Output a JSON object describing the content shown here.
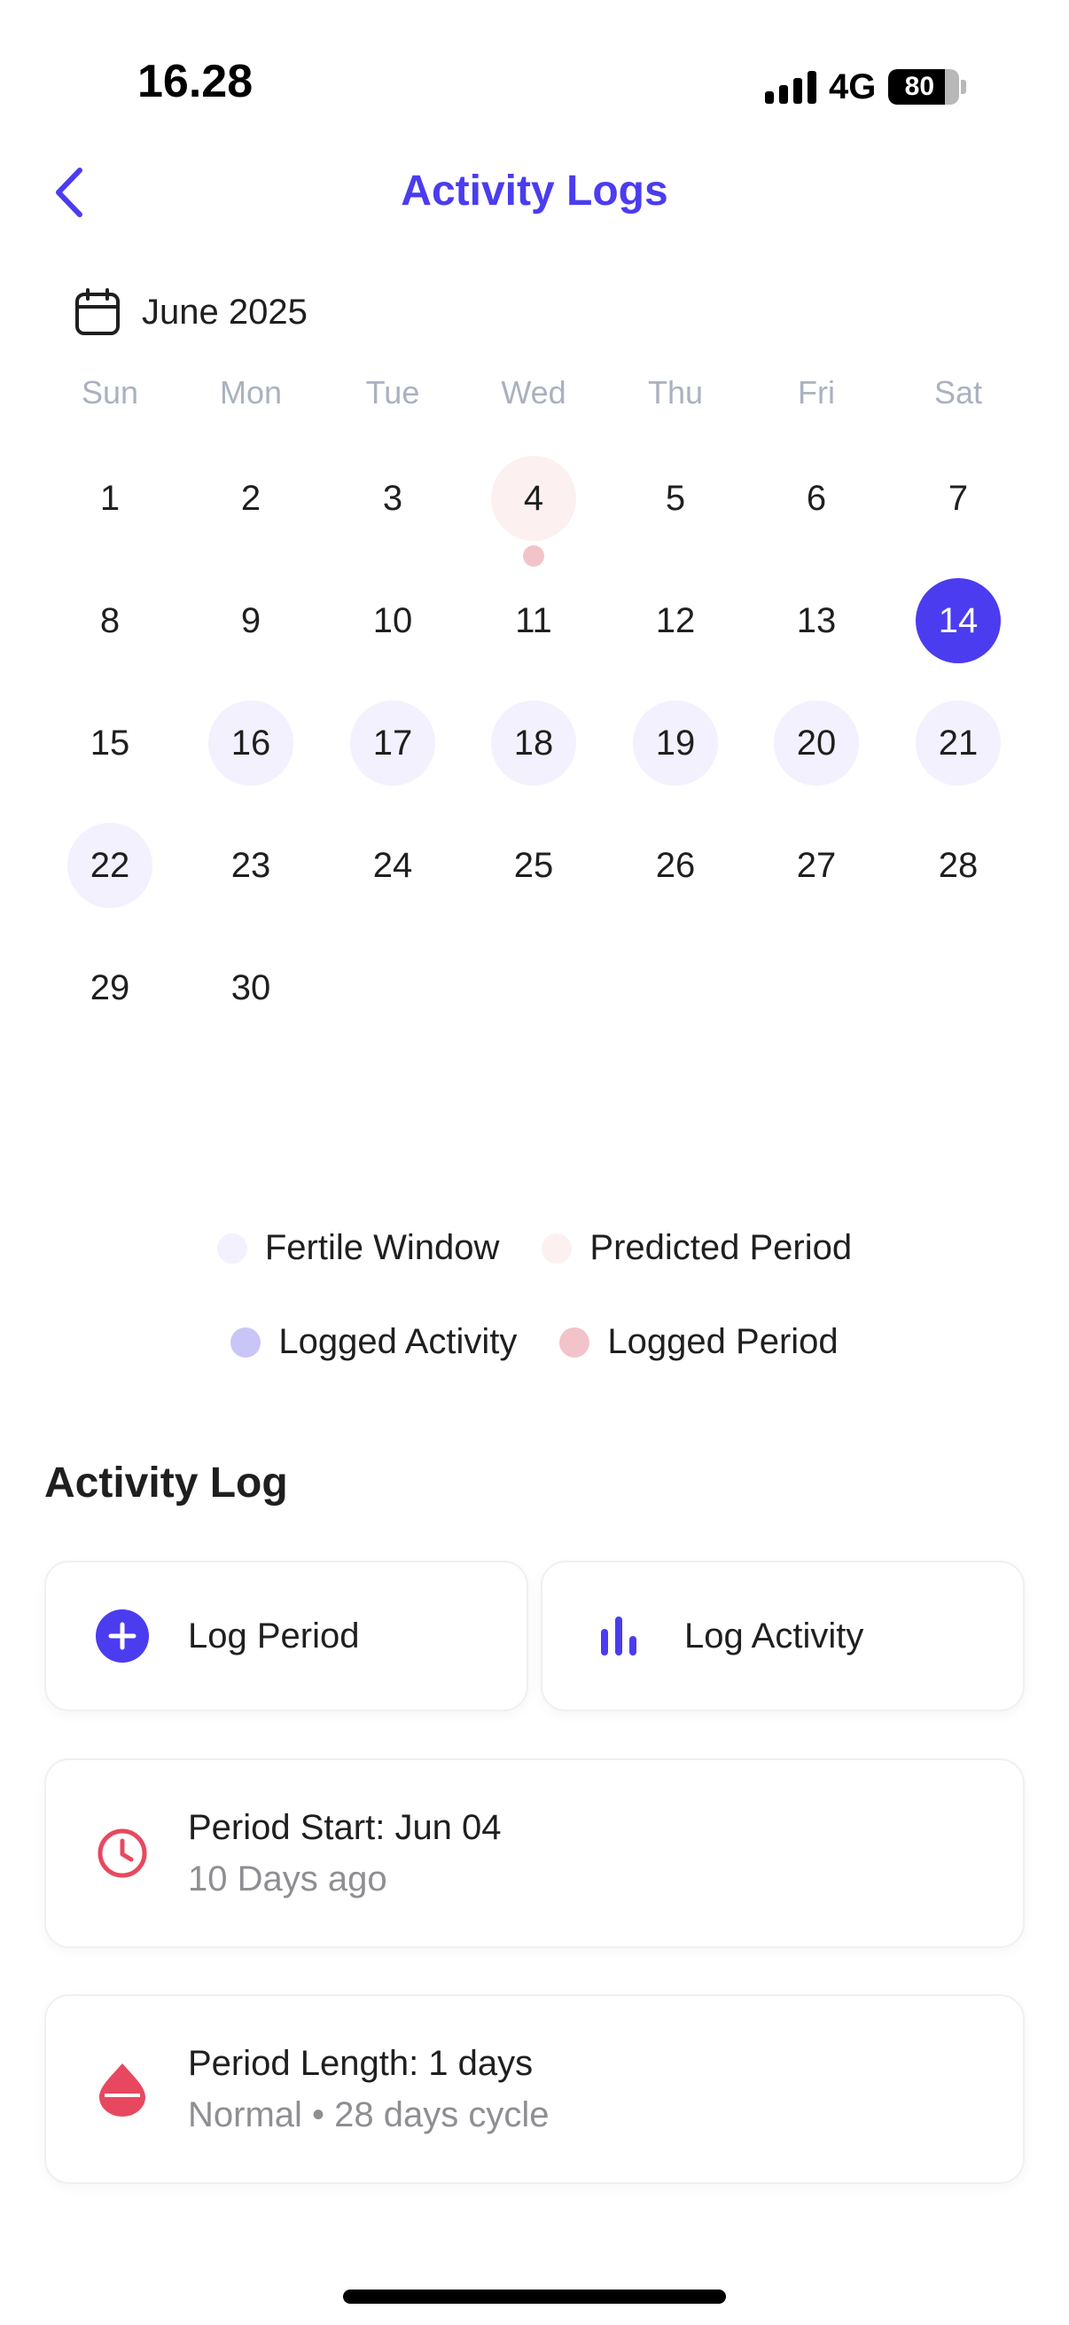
{
  "status_bar": {
    "time": "16.28",
    "network": "4G",
    "battery": "80",
    "battery_level": 0.8
  },
  "header": {
    "title": "Activity Logs"
  },
  "calendar": {
    "month_label": "June 2025",
    "weekdays": [
      "Sun",
      "Mon",
      "Tue",
      "Wed",
      "Thu",
      "Fri",
      "Sat"
    ],
    "days": [
      {
        "label": "1"
      },
      {
        "label": "2"
      },
      {
        "label": "3"
      },
      {
        "label": "4",
        "state": "predicted",
        "period_dot": true
      },
      {
        "label": "5"
      },
      {
        "label": "6"
      },
      {
        "label": "7"
      },
      {
        "label": "8"
      },
      {
        "label": "9"
      },
      {
        "label": "10"
      },
      {
        "label": "11"
      },
      {
        "label": "12"
      },
      {
        "label": "13"
      },
      {
        "label": "14",
        "state": "selected"
      },
      {
        "label": "15"
      },
      {
        "label": "16",
        "state": "fertile"
      },
      {
        "label": "17",
        "state": "fertile"
      },
      {
        "label": "18",
        "state": "fertile"
      },
      {
        "label": "19",
        "state": "fertile"
      },
      {
        "label": "20",
        "state": "fertile"
      },
      {
        "label": "21",
        "state": "fertile"
      },
      {
        "label": "22",
        "state": "fertile"
      },
      {
        "label": "23"
      },
      {
        "label": "24"
      },
      {
        "label": "25"
      },
      {
        "label": "26"
      },
      {
        "label": "27"
      },
      {
        "label": "28"
      },
      {
        "label": "29"
      },
      {
        "label": "30"
      }
    ]
  },
  "legend": [
    {
      "label": "Fertile Window",
      "color": "#f2f1fd"
    },
    {
      "label": "Predicted Period",
      "color": "#fdf0f1"
    },
    {
      "label": "Logged Activity",
      "color": "#cac5f7"
    },
    {
      "label": "Logged Period",
      "color": "#f2c4ca"
    }
  ],
  "activity_log": {
    "title": "Activity Log",
    "log_period_label": "Log Period",
    "log_activity_label": "Log Activity",
    "period_start": {
      "title": "Period Start: Jun 04",
      "subtitle": "10 Days ago"
    },
    "period_length": {
      "title": "Period Length: 1 days",
      "subtitle": "Normal • 28 days cycle"
    }
  },
  "colors": {
    "accent": "#4b3cf0",
    "period": "#e8485f",
    "fertile": "#f2f1fd",
    "predicted": "#fdf0f1"
  }
}
